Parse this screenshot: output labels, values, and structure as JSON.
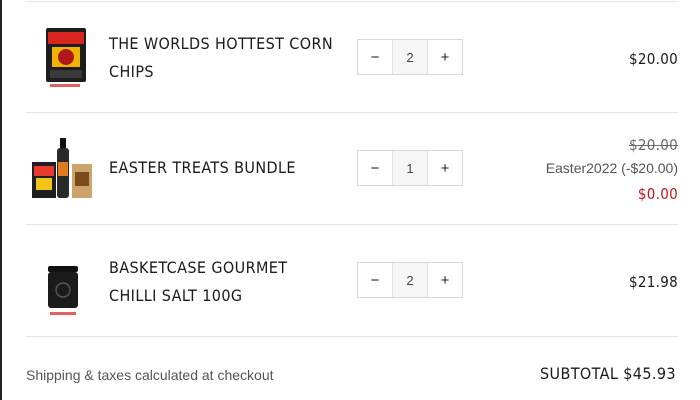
{
  "cart": {
    "items": [
      {
        "name": "THE WORLDS HOTTEST CORN CHIPS",
        "quantity": "2",
        "price": "$20.00"
      },
      {
        "name": "EASTER TREATS BUNDLE",
        "quantity": "1",
        "original_price": "$20.00",
        "discount_label": "Easter2022 (-$20.00)",
        "final_price": "$0.00"
      },
      {
        "name": "BASKETCASE GOURMET CHILLI SALT 100G",
        "quantity": "2",
        "price": "$21.98"
      }
    ],
    "controls": {
      "decrease": "−",
      "increase": "+"
    },
    "footer": {
      "note": "Shipping & taxes calculated at checkout",
      "subtotal_label": "SUBTOTAL",
      "subtotal_value": "$45.93"
    }
  },
  "colors": {
    "accent_red": "#c0161b",
    "text_dark": "#1a1a1a",
    "divider": "#e6e6e6"
  }
}
